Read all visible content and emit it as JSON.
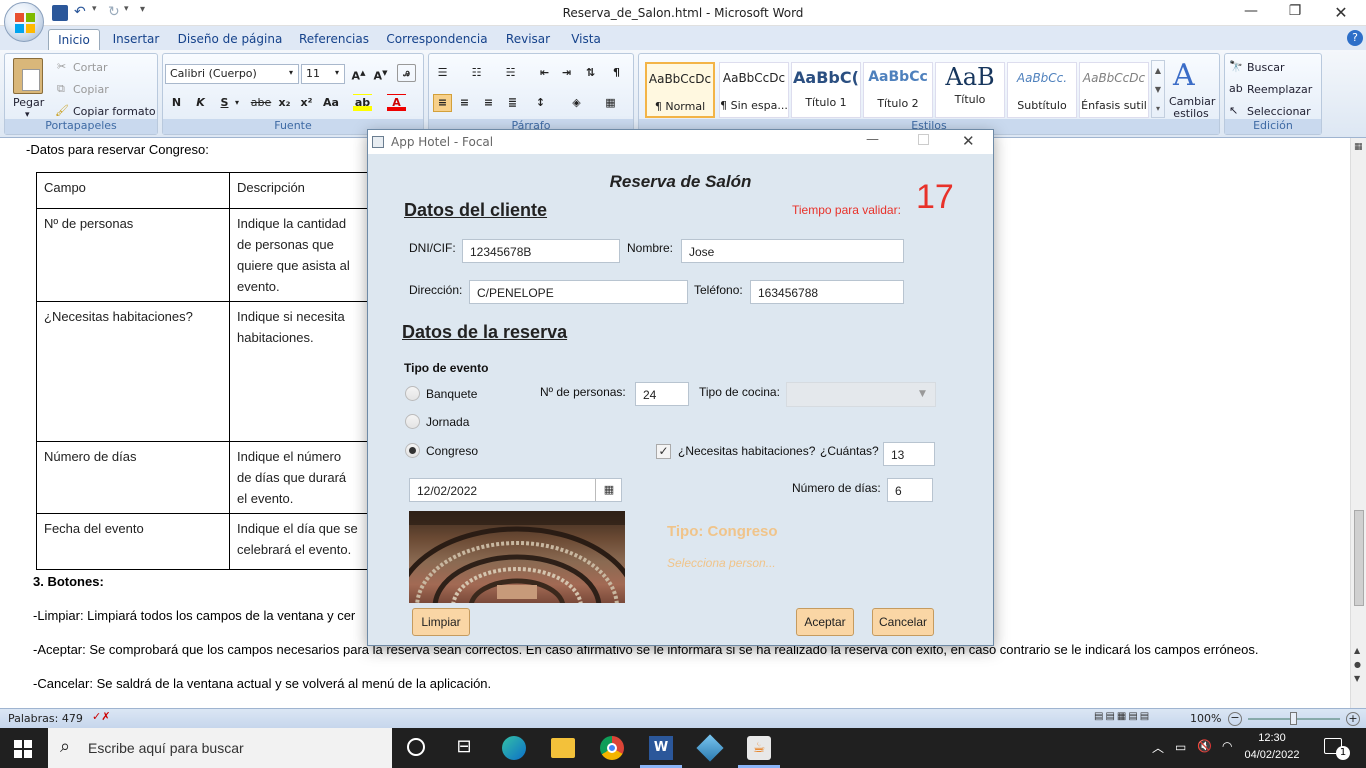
{
  "word": {
    "window_title": "Reserva_de_Salon.html - Microsoft Word",
    "tabs": [
      "Inicio",
      "Insertar",
      "Diseño de página",
      "Referencias",
      "Correspondencia",
      "Revisar",
      "Vista"
    ],
    "active_tab": "Inicio",
    "clipboard": {
      "paste": "Pegar",
      "cut": "Cortar",
      "copy": "Copiar",
      "format_painter": "Copiar formato",
      "caption": "Portapapeles"
    },
    "font": {
      "name": "Calibri (Cuerpo)",
      "size": "11",
      "caption": "Fuente",
      "bold": "N",
      "italic": "K",
      "underline": "S",
      "strike": "abe",
      "sub": "x₂",
      "sup": "x²",
      "case": "Aa"
    },
    "paragraph": {
      "caption": "Párrafo"
    },
    "styles": {
      "caption": "Estilos",
      "items": [
        {
          "sample": "AaBbCcDc",
          "name": "¶ Normal"
        },
        {
          "sample": "AaBbCcDc",
          "name": "¶ Sin espa..."
        },
        {
          "sample": "AaBbC(",
          "name": "Título 1"
        },
        {
          "sample": "AaBbCc",
          "name": "Título 2"
        },
        {
          "sample": "AaB",
          "name": "Título"
        },
        {
          "sample": "AaBbCc.",
          "name": "Subtítulo"
        },
        {
          "sample": "AaBbCcDc",
          "name": "Énfasis sutil"
        }
      ],
      "change": "Cambiar estilos"
    },
    "editing": {
      "find": "Buscar",
      "replace": "Reemplazar",
      "select": "Seleccionar",
      "caption": "Edición"
    },
    "status": {
      "words": "Palabras: 479",
      "zoom": "100%"
    }
  },
  "document": {
    "intro": "-Datos para reservar Congreso:",
    "table_rows": [
      [
        "Campo",
        "Descripción"
      ],
      [
        "Nº de personas",
        "Indique la cantidad de personas que quiere que asista al evento."
      ],
      [
        "¿Necesitas habitaciones?",
        "Indique si necesita habitaciones."
      ],
      [
        "Número de días",
        "Indique el número de días que durará el evento."
      ],
      [
        "Fecha del evento",
        "Indique el día que se celebrará el evento."
      ]
    ],
    "section": "3.    Botones:",
    "p1": "-Limpiar: Limpiará todos los campos de la ventana y cer",
    "p2": "-Aceptar: Se comprobará que los campos necesarios para la reserva sean correctos. En caso afirmativo se le informará si se ha realizado la reserva con éxito, en caso contrario se le indicará los campos erróneos.",
    "p3": "-Cancelar: Se saldrá de la ventana actual y se volverá al menú de la aplicación."
  },
  "dialog": {
    "window_title": "App Hotel - Focal",
    "heading": "Reserva de Salón",
    "client_section": "Datos del cliente",
    "timer_label": "Tiempo para validar:",
    "timer_value": "17",
    "dni_label": "DNI/CIF:",
    "dni_value": "12345678B",
    "name_label": "Nombre:",
    "name_value": "Jose",
    "address_label": "Dirección:",
    "address_value": "C/PENELOPE",
    "phone_label": "Teléfono:",
    "phone_value": "163456788",
    "booking_section": "Datos de la reserva",
    "event_type_label": "Tipo de evento",
    "radios": [
      "Banquete",
      "Jornada",
      "Congreso"
    ],
    "selected_radio": "Congreso",
    "people_label": "Nº de personas:",
    "people_value": "24",
    "cuisine_label": "Tipo de cocina:",
    "rooms_label": "¿Necesitas habitaciones?",
    "rooms_checked": true,
    "how_many_label": "¿Cuántas?",
    "how_many_value": "13",
    "date_value": "12/02/2022",
    "days_label": "Número de días:",
    "days_value": "6",
    "type_text": "Tipo: Congreso",
    "select_hint": "Selecciona person...",
    "clear_btn": "Limpiar",
    "accept_btn": "Aceptar",
    "cancel_btn": "Cancelar"
  },
  "taskbar": {
    "search_placeholder": "Escribe aquí para buscar",
    "time": "12:30",
    "date": "04/02/2022",
    "notifications": "1"
  },
  "colors": {
    "accent_orange": "#fad6a5",
    "timer_red": "#e8322a",
    "type_text": "#f0c48a",
    "word_blue": "#15428b"
  }
}
